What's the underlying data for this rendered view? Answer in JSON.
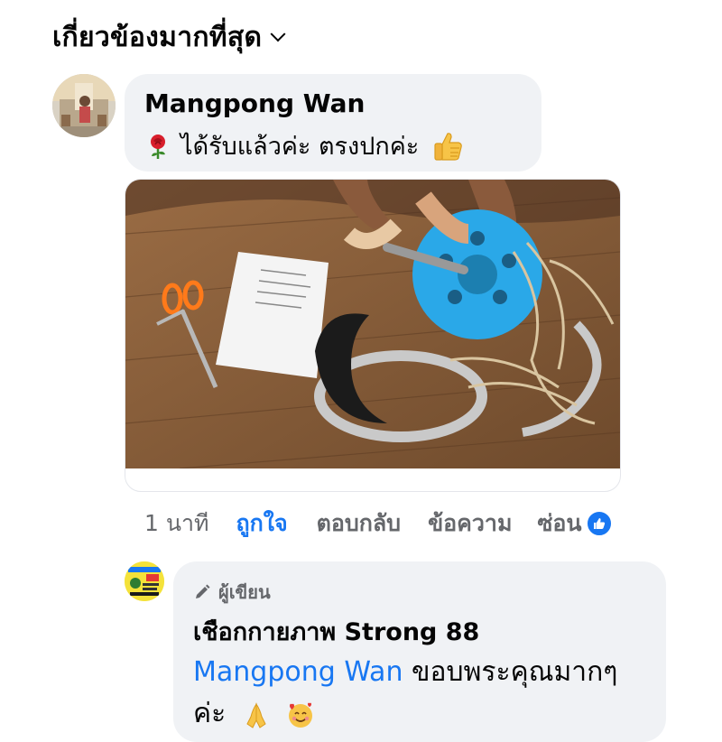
{
  "sort": {
    "label": "เกี่ยวข้องมากที่สุด"
  },
  "comment": {
    "author": "Mangpong Wan",
    "text": "ได้รับแล้วค่ะ ตรงปกค่ะ",
    "emoji_start": "rose-emoji",
    "emoji_end": "thumbs-up-emoji"
  },
  "actions": {
    "time": "1 นาที",
    "like": "ถูกใจ",
    "reply": "ตอบกลับ",
    "message": "ข้อความ",
    "hide": "ซ่อน",
    "reaction_icon": "like-reaction-icon"
  },
  "reply": {
    "badge": "ผู้เขียน",
    "page_name": "เชือกกายภาพ Strong 88",
    "mention": "Mangpong Wan",
    "text": " ขอบพระคุณมากๆ ค่ะ",
    "emojis": [
      "folded-hands-emoji",
      "smiling-face-with-hearts-emoji"
    ]
  },
  "colors": {
    "accent": "#1877f2",
    "bubble": "#f0f2f5",
    "muted": "#65676b"
  }
}
